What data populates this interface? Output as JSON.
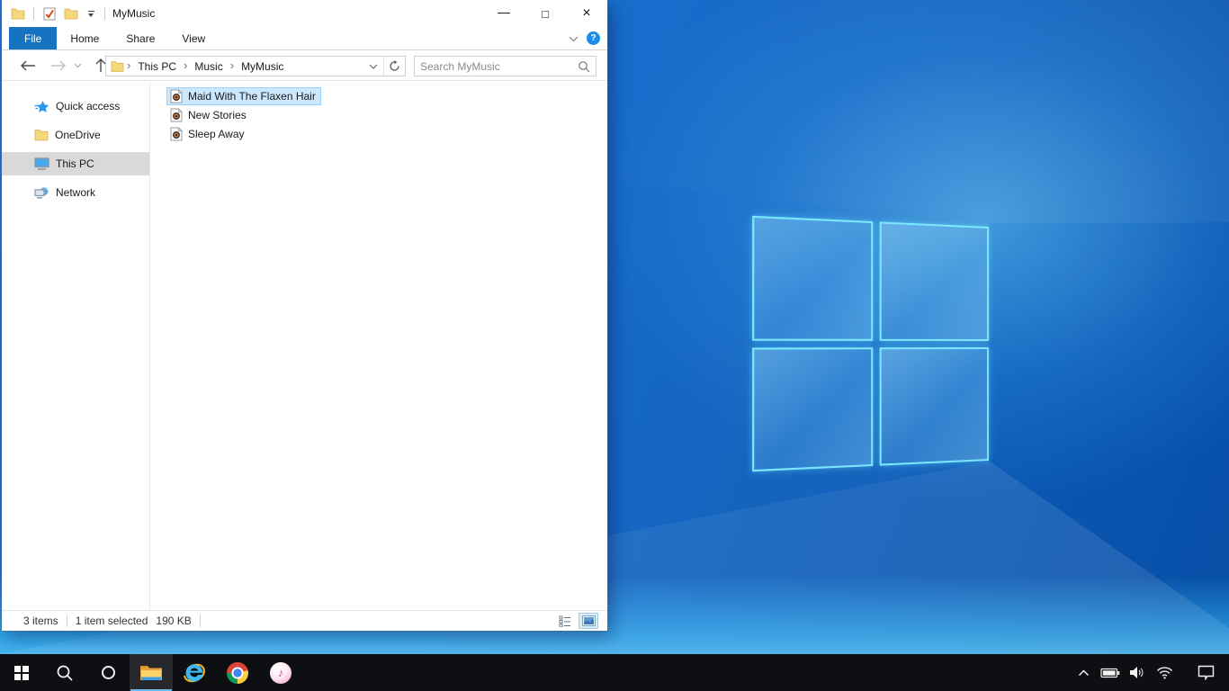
{
  "desktop": {
    "wallpaper": "windows-10-light-theme-logo"
  },
  "explorer": {
    "title": "MyMusic",
    "window_controls": {
      "minimize": "—",
      "maximize": "□",
      "close": "×"
    },
    "ribbon_tabs": [
      {
        "label": "File"
      },
      {
        "label": "Home"
      },
      {
        "label": "Share"
      },
      {
        "label": "View"
      }
    ],
    "help_label": "?",
    "navbar": {
      "breadcrumb": [
        "This PC",
        "Music",
        "MyMusic"
      ],
      "crumb_separator": "›",
      "search_placeholder": "Search MyMusic"
    },
    "sidebar": {
      "items": [
        {
          "label": "Quick access"
        },
        {
          "label": "OneDrive"
        },
        {
          "label": "This PC"
        },
        {
          "label": "Network"
        }
      ]
    },
    "files": [
      {
        "name": "Maid With The Flaxen Hair"
      },
      {
        "name": "New Stories"
      },
      {
        "name": "Sleep Away"
      }
    ],
    "statusbar": {
      "count": "3 items",
      "selected": "1 item selected",
      "size": "190 KB"
    }
  },
  "taskbar": {
    "buttons": [
      "start",
      "search",
      "cortana",
      "file-explorer",
      "internet-explorer",
      "chrome",
      "itunes"
    ],
    "active_app": "file-explorer",
    "tray_icons": [
      "hidden-icons-chevron",
      "battery",
      "volume",
      "wifi"
    ],
    "action_center": "action-center"
  },
  "colors": {
    "accent_blue": "#1673c0",
    "file_selection_bg": "#cce8ff",
    "file_selection_border": "#99d1ff",
    "sidebar_selected_bg": "#d9d9d9",
    "taskbar_bg": "#0d0f12",
    "taskbar_active_underline": "#6fb8ee",
    "wallpaper_base": "#0a64c8",
    "logo_edge_cyan": "#7de8ff"
  }
}
